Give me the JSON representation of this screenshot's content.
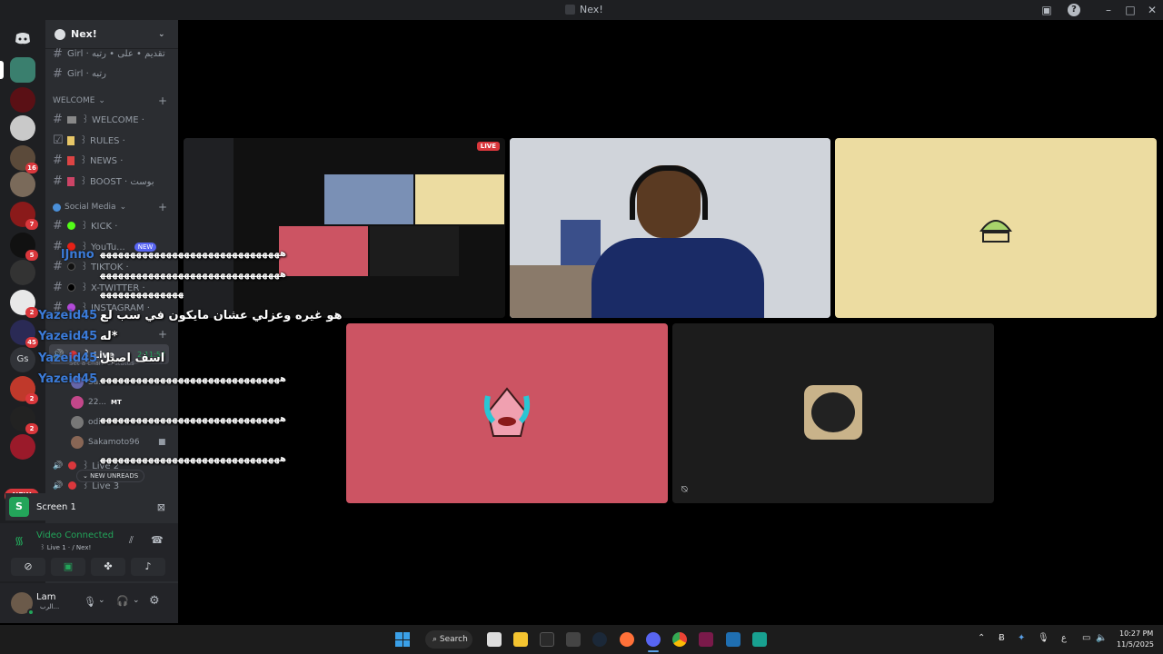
{
  "window": {
    "title": "Nex!"
  },
  "guild": {
    "name": "Nex!"
  },
  "servers": {
    "badges": [
      "16",
      "7",
      "5",
      "2",
      "45",
      "2",
      "2"
    ],
    "gs_label": "Gs",
    "new_label": "NEW"
  },
  "channels": {
    "top": [
      {
        "name": "Girl · تقديم • على • رتبه"
      },
      {
        "name": "Girl · رتبه"
      }
    ],
    "cat_welcome": "WELCOME",
    "welcome_items": [
      {
        "name": "꒱ WELCOME ·"
      },
      {
        "name": "꒱ RULES ·"
      },
      {
        "name": "꒱ NEWS ·"
      },
      {
        "name": "꒱ BOOST · بوست"
      }
    ],
    "cat_social": "Social Media",
    "social_items": [
      {
        "name": "꒱ KICK ·"
      },
      {
        "name": "꒱ YouTu...",
        "badge": "NEW"
      },
      {
        "name": "꒱ TIKTOK ·"
      },
      {
        "name": "꒱ X-TWITTER ·"
      },
      {
        "name": "꒱ INSTAGRAM ·"
      }
    ],
    "live_channel": "꒱ Live",
    "live_timer": "2:11:54",
    "set_status": "Set a channel status",
    "voice_users": [
      {
        "name": "Sa..."
      },
      {
        "name": "22...",
        "tag": "MT"
      },
      {
        "name": "odi..."
      },
      {
        "name": "Sakamoto96"
      }
    ],
    "live_items": [
      "꒱ Live 2",
      "꒱ Live 3"
    ],
    "new_unreads": "NEW UNREADS"
  },
  "screen_panel": {
    "label": "Screen 1"
  },
  "voice": {
    "status": "Video Connected",
    "channel": "꒱ Live 1 · / Nex!"
  },
  "user": {
    "name": "Lam",
    "status": "الرب..."
  },
  "overlay": {
    "name1": "lJnno",
    "name2": "Yazeid45",
    "name3": "Yazeid45",
    "name4": "Yazeid45",
    "name5": "Yazeid45",
    "msg_arabic1": "هو غيره وعزلي عشان مايكون في سب لع",
    "msg_arabic2": "له*",
    "msg_arabic3": "اسف اصيل",
    "wave": "ﻫﻬﻬﻬﻬﻬﻬﻬﻬﻬﻬﻬﻬﻬﻬﻬﻬﻬﻬﻬﻬﻬﻬﻬﻬﻬﻬﻬﻬﻬﻬ"
  },
  "stream": {
    "live_badge": "LIVE"
  },
  "taskbar": {
    "search_label": "Search",
    "time": "10:27 PM",
    "date": "11/5/2025",
    "lang": "ع"
  },
  "colors": {
    "pink_tile": "#cc5463",
    "cream_tile": "#ecdca1",
    "dark_tile": "#1c1c1c",
    "discord_green": "#23a55a",
    "live_red": "#da373c",
    "brand": "#5865f2"
  }
}
